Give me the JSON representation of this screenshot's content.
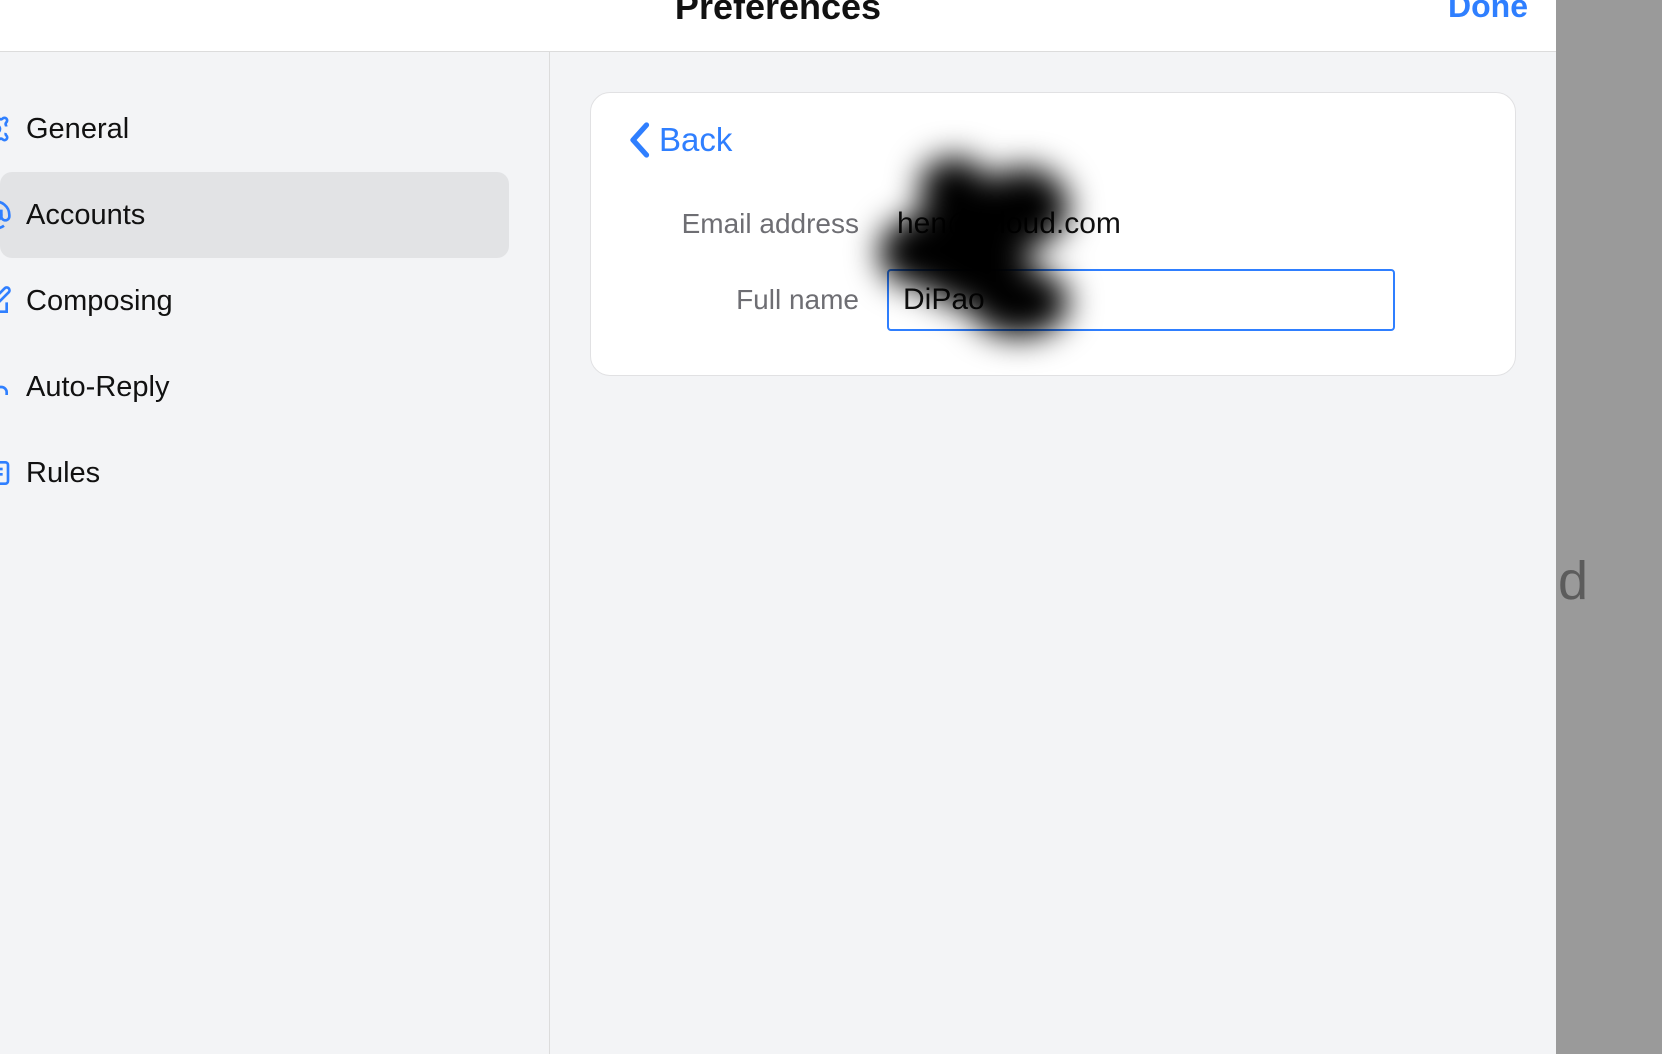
{
  "header": {
    "title": "Preferences",
    "done_label": "Done"
  },
  "sidebar": {
    "items": [
      {
        "label": "General"
      },
      {
        "label": "Accounts"
      },
      {
        "label": "Composing"
      },
      {
        "label": "Auto-Reply"
      },
      {
        "label": "Rules"
      }
    ],
    "selected_index": 1
  },
  "account_detail": {
    "back_label": "Back",
    "email_label": "Email address",
    "email_value": "hen@icloud.com",
    "fullname_label": "Full name",
    "fullname_value": "DiPao"
  },
  "colors": {
    "accent": "#2f7fff"
  },
  "background_hint": "d"
}
